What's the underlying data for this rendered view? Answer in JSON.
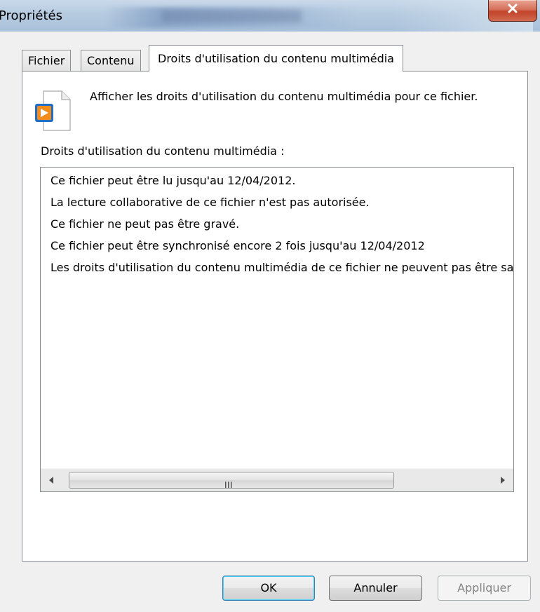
{
  "window": {
    "title": "Propriétés",
    "close_glyph": "X"
  },
  "tabs": [
    {
      "label": "Fichier",
      "active": false
    },
    {
      "label": "Contenu",
      "active": false
    },
    {
      "label": "Droits d'utilisation du contenu multimédia",
      "active": true
    }
  ],
  "panel": {
    "info_text": "Afficher les droits d'utilisation du contenu multimédia pour ce fichier.",
    "icon": "media-file-icon",
    "section_label": "Droits d'utilisation du contenu multimédia :",
    "rights": [
      "Ce fichier peut être lu jusqu'au 12/04/2012.",
      "La lecture collaborative de ce fichier n'est pas autorisée.",
      "Ce fichier ne peut pas être gravé.",
      "Ce fichier peut être synchronisé encore 2 fois jusqu'au 12/04/2012",
      "Les droits d'utilisation du contenu multimédia de ce fichier ne peuvent pas être sauvegardés."
    ],
    "scrollbar_grip": "III"
  },
  "buttons": {
    "ok": "OK",
    "cancel": "Annuler",
    "apply": "Appliquer",
    "apply_enabled": false
  },
  "colors": {
    "titlebar": "#b6cbe0",
    "close": "#c2432a",
    "ok_focus": "#48d1f8",
    "media_icon_orange": "#f28c1c",
    "media_icon_blue": "#1f6fc4"
  }
}
